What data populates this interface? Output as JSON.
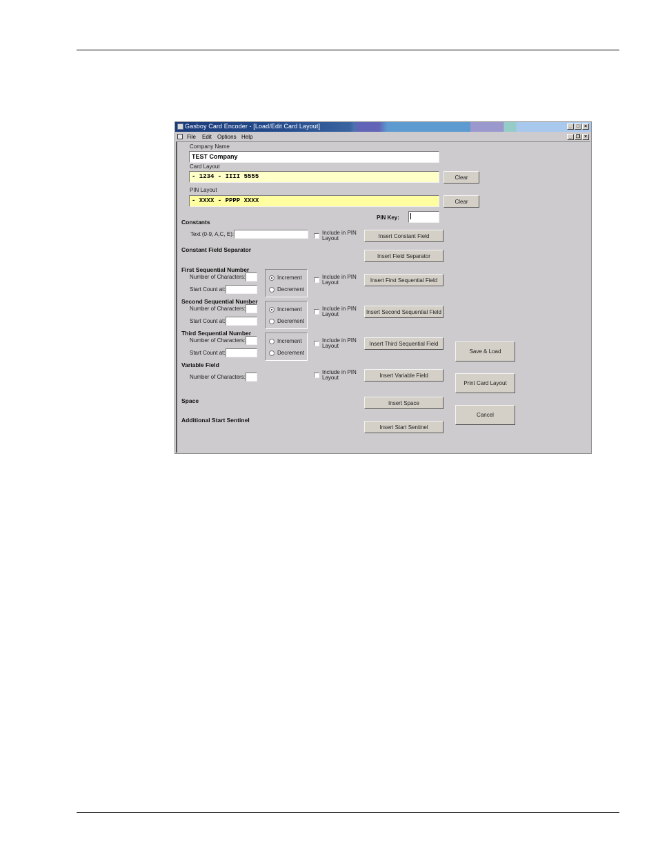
{
  "window": {
    "title": "Gasboy Card Encoder - [Load/Edit Card Layout]",
    "caption_buttons": [
      "minimize",
      "maximize",
      "close"
    ],
    "mdi_buttons": [
      "minimize",
      "restore",
      "close"
    ]
  },
  "menu": {
    "items": [
      {
        "label": "File",
        "accel": "F"
      },
      {
        "label": "Edit",
        "accel": "E"
      },
      {
        "label": "Options",
        "accel": "O"
      },
      {
        "label": "Help",
        "accel": "H"
      }
    ]
  },
  "form": {
    "company_name_label": "Company Name",
    "company_name_value": "TEST Company",
    "card_layout_label": "Card Layout",
    "card_layout_value": "- 1234 - IIII 5555",
    "card_clear_label": "Clear",
    "pin_layout_label": "PIN Layout",
    "pin_layout_value": "- XXXX - PPPP XXXX",
    "pin_clear_label": "Clear",
    "pin_key_label": "PIN Key:",
    "pin_key_value": "",
    "constants": {
      "heading": "Constants",
      "text_label": "Text (0-9, A,C, E):",
      "text_value": "",
      "include_label": "Include in PIN Layout",
      "include_checked": false,
      "button_label": "Insert  Constant Field"
    },
    "separator": {
      "heading": "Constant Field Separator",
      "button_label": "Insert  Field Separator"
    },
    "sequential": [
      {
        "heading": "First Sequential Number",
        "num_chars_label": "Number of Characters:",
        "num_chars_value": "",
        "start_label": "Start Count at:",
        "start_value": "",
        "increment_label": "Increment",
        "decrement_label": "Decrement",
        "selected": "increment",
        "include_label": "Include in PIN Layout",
        "include_checked": false,
        "button_label": "Insert First Sequential Field"
      },
      {
        "heading": "Second Sequential Number",
        "num_chars_label": "Number of Characters:",
        "num_chars_value": "",
        "start_label": "Start Count at:",
        "start_value": "",
        "increment_label": "Increment",
        "decrement_label": "Decrement",
        "selected": "increment",
        "include_label": "Include in PIN Layout",
        "include_checked": false,
        "button_label": "Insert  Second Sequential Field"
      },
      {
        "heading": "Third Sequential Number",
        "num_chars_label": "Number of Characters:",
        "num_chars_value": "",
        "start_label": "Start Count at:",
        "start_value": "",
        "increment_label": "Increment",
        "decrement_label": "Decrement",
        "selected": "none",
        "include_label": "Include in PIN Layout",
        "include_checked": false,
        "button_label": "Insert  Third Sequential Field"
      }
    ],
    "variable": {
      "heading": "Variable Field",
      "num_chars_label": "Number of Characters:",
      "num_chars_value": "",
      "include_label": "Include in PIN Layout",
      "include_checked": false,
      "button_label": "Insert  Variable Field"
    },
    "space": {
      "heading": "Space",
      "button_label": "Insert Space"
    },
    "sentinel": {
      "heading": "Additional Start Sentinel",
      "button_label": "Insert Start Sentinel"
    }
  },
  "actions": {
    "save_label": "Save & Load",
    "print_label": "Print Card Layout",
    "cancel_label": "Cancel"
  }
}
